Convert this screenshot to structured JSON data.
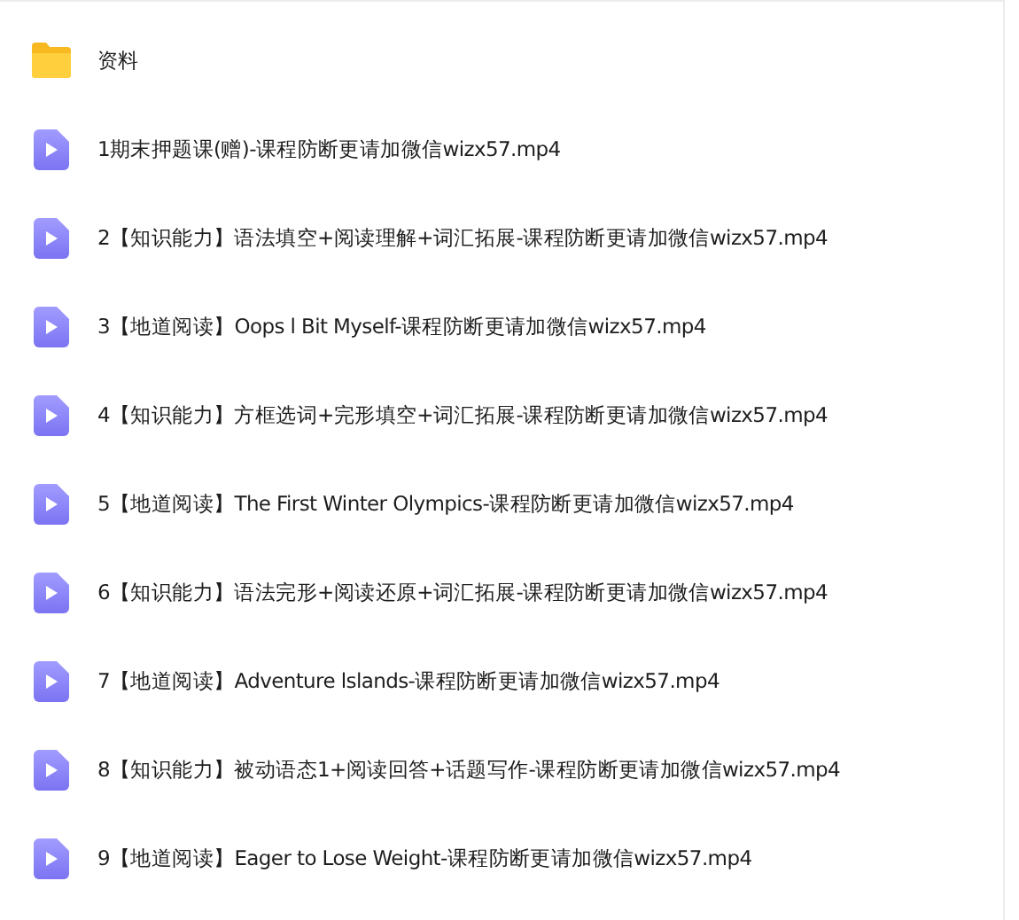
{
  "files": [
    {
      "kind": "folder",
      "name": "资料"
    },
    {
      "kind": "video",
      "name": "1期末押题课(赠)-课程防断更请加微信wizx57.mp4"
    },
    {
      "kind": "video",
      "name": "2【知识能力】语法填空+阅读理解+词汇拓展-课程防断更请加微信wizx57.mp4"
    },
    {
      "kind": "video",
      "name": "3【地道阅读】Oops l Bit Myself-课程防断更请加微信wizx57.mp4"
    },
    {
      "kind": "video",
      "name": "4【知识能力】方框选词+完形填空+词汇拓展-课程防断更请加微信wizx57.mp4"
    },
    {
      "kind": "video",
      "name": "5【地道阅读】The First Winter Olympics-课程防断更请加微信wizx57.mp4"
    },
    {
      "kind": "video",
      "name": "6【知识能力】语法完形+阅读还原+词汇拓展-课程防断更请加微信wizx57.mp4"
    },
    {
      "kind": "video",
      "name": "7【地道阅读】Adventure lslands-课程防断更请加微信wizx57.mp4"
    },
    {
      "kind": "video",
      "name": "8【知识能力】被动语态1+阅读回答+话题写作-课程防断更请加微信wizx57.mp4"
    },
    {
      "kind": "video",
      "name": "9【地道阅读】Eager to Lose Weight-课程防断更请加微信wizx57.mp4"
    }
  ]
}
